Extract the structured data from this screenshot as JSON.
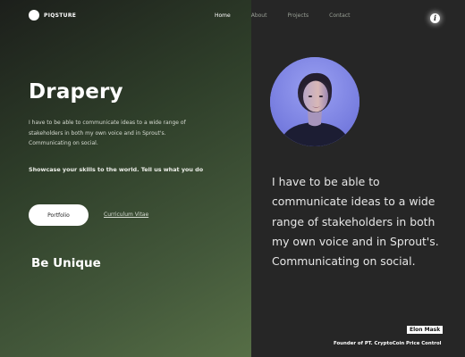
{
  "brand": {
    "name": "PIQSTURE"
  },
  "nav": {
    "items": [
      {
        "label": "Home",
        "active": true
      },
      {
        "label": "About",
        "active": false
      },
      {
        "label": "Projects",
        "active": false
      },
      {
        "label": "Contact",
        "active": false
      }
    ],
    "info_icon": "info-icon",
    "info_glyph": "i"
  },
  "hero": {
    "title": "Drapery",
    "description": "I have to be able to communicate ideas to a wide range of stakeholders in both my own voice and in Sprout's. Communicating on social.",
    "cta_text": "Showcase your skills to the world. Tell us what you do",
    "primary_button": "Portfolio",
    "secondary_link": "Curriculum Vitae",
    "tagline": "Be Unique"
  },
  "testimonial": {
    "avatar": "person-portrait",
    "quote": "I have to be able to communicate ideas to a wide range of stakeholders in both my own voice and in Sprout's. Communicating on social.",
    "author_name": "Elon Mask",
    "author_role": "Founder of PT. CryptoCoin Price Control"
  },
  "colors": {
    "left_gradient_start": "#1c1f1b",
    "left_gradient_end": "#566e46",
    "right_background": "#262626",
    "avatar_background": "#7a82e6",
    "text_primary": "#ffffff",
    "nav_inactive": "#9aa096"
  }
}
